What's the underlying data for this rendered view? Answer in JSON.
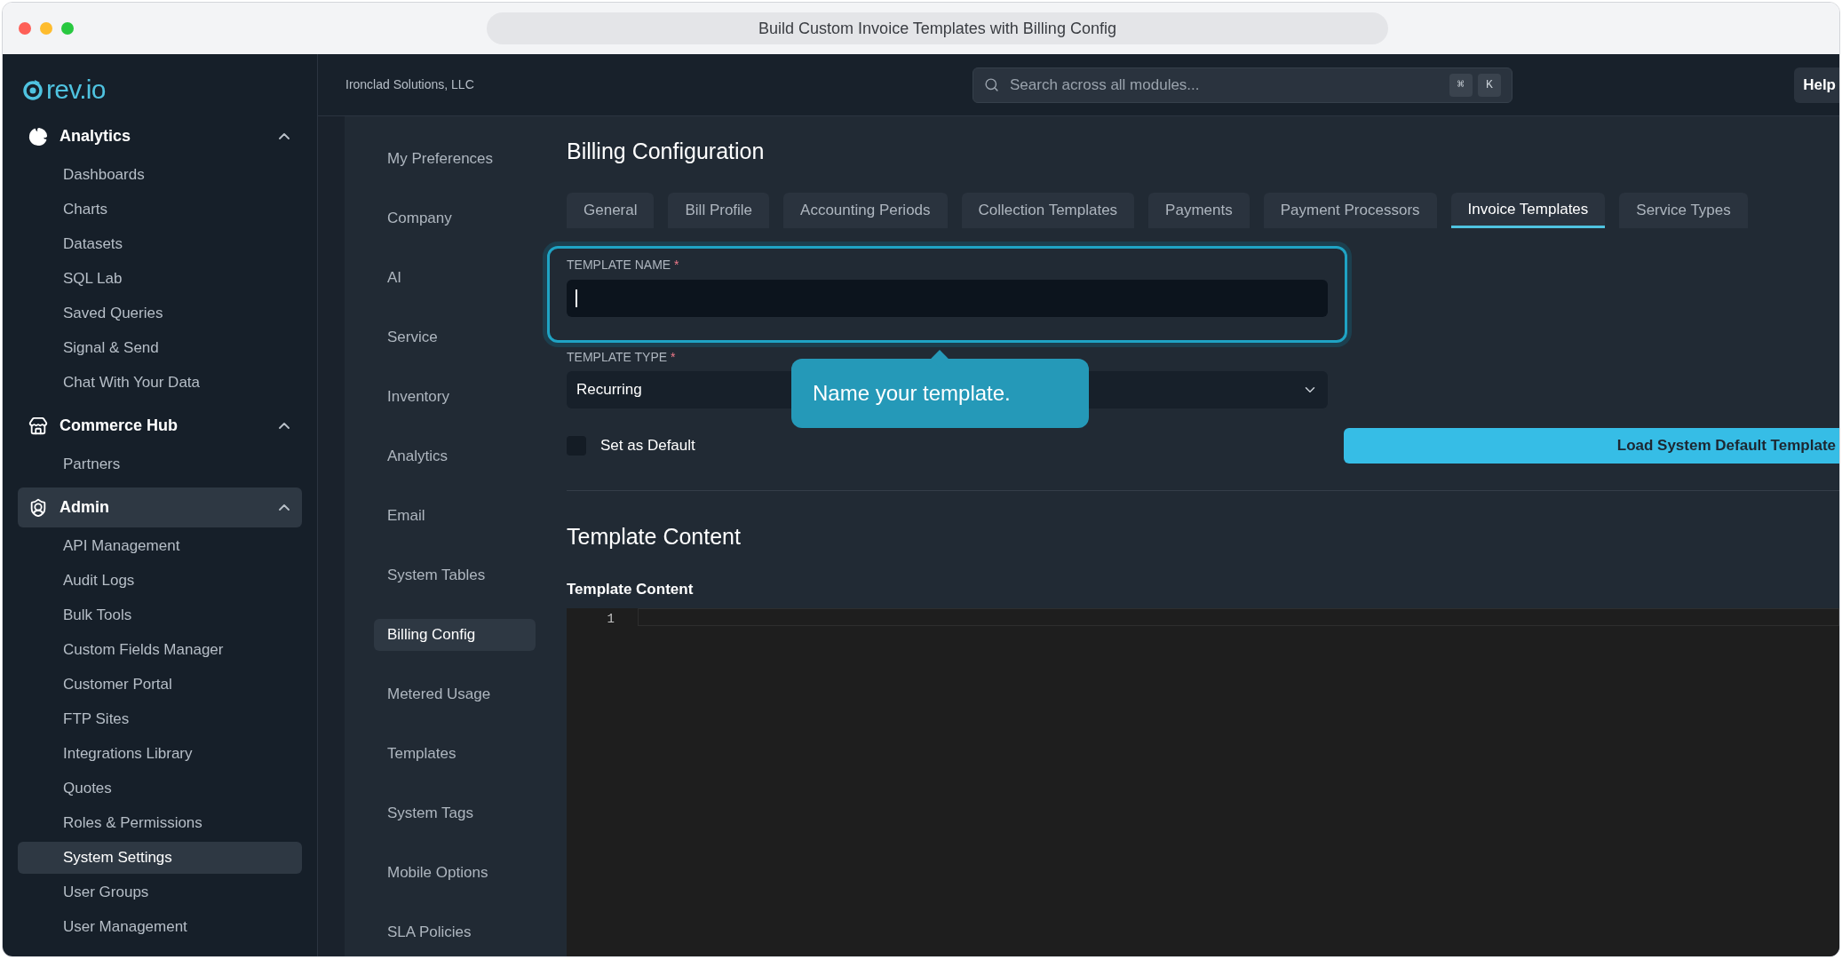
{
  "window": {
    "title": "Build Custom Invoice Templates with Billing Config"
  },
  "sidebar": {
    "logo": "rev.io",
    "sections": [
      {
        "label": "Analytics",
        "expanded": true,
        "active": false,
        "items": [
          {
            "label": "Dashboards",
            "selected": false
          },
          {
            "label": "Charts",
            "selected": false
          },
          {
            "label": "Datasets",
            "selected": false
          },
          {
            "label": "SQL Lab",
            "selected": false
          },
          {
            "label": "Saved Queries",
            "selected": false
          },
          {
            "label": "Signal & Send",
            "selected": false
          },
          {
            "label": "Chat With Your Data",
            "selected": false
          }
        ]
      },
      {
        "label": "Commerce Hub",
        "expanded": true,
        "active": false,
        "items": [
          {
            "label": "Partners",
            "selected": false
          }
        ]
      },
      {
        "label": "Admin",
        "expanded": true,
        "active": true,
        "items": [
          {
            "label": "API Management",
            "selected": false
          },
          {
            "label": "Audit Logs",
            "selected": false
          },
          {
            "label": "Bulk Tools",
            "selected": false
          },
          {
            "label": "Custom Fields Manager",
            "selected": false
          },
          {
            "label": "Customer Portal",
            "selected": false
          },
          {
            "label": "FTP Sites",
            "selected": false
          },
          {
            "label": "Integrations Library",
            "selected": false
          },
          {
            "label": "Quotes",
            "selected": false
          },
          {
            "label": "Roles & Permissions",
            "selected": false
          },
          {
            "label": "System Settings",
            "selected": true
          },
          {
            "label": "User Groups",
            "selected": false
          },
          {
            "label": "User Management",
            "selected": false
          }
        ]
      }
    ]
  },
  "header": {
    "company": "Ironclad Solutions, LLC",
    "search": {
      "placeholder": "Search across all modules...",
      "keys": [
        "⌘",
        "K"
      ]
    },
    "help_button": "Help"
  },
  "settings_nav": [
    {
      "label": "My Preferences",
      "selected": false
    },
    {
      "label": "Company",
      "selected": false
    },
    {
      "label": "AI",
      "selected": false
    },
    {
      "label": "Service",
      "selected": false
    },
    {
      "label": "Inventory",
      "selected": false
    },
    {
      "label": "Analytics",
      "selected": false
    },
    {
      "label": "Email",
      "selected": false
    },
    {
      "label": "System Tables",
      "selected": false
    },
    {
      "label": "Billing Config",
      "selected": true
    },
    {
      "label": "Metered Usage",
      "selected": false
    },
    {
      "label": "Templates",
      "selected": false
    },
    {
      "label": "System Tags",
      "selected": false
    },
    {
      "label": "Mobile Options",
      "selected": false
    },
    {
      "label": "SLA Policies",
      "selected": false
    }
  ],
  "page": {
    "title": "Billing Configuration",
    "tabs": [
      {
        "label": "General",
        "selected": false
      },
      {
        "label": "Bill Profile",
        "selected": false
      },
      {
        "label": "Accounting Periods",
        "selected": false
      },
      {
        "label": "Collection Templates",
        "selected": false
      },
      {
        "label": "Payments",
        "selected": false
      },
      {
        "label": "Payment Processors",
        "selected": false
      },
      {
        "label": "Invoice Templates",
        "selected": true
      },
      {
        "label": "Service Types",
        "selected": false
      }
    ],
    "template_name": {
      "label": "TEMPLATE NAME",
      "required_mark": "*",
      "focused": true
    },
    "template_type": {
      "label": "TEMPLATE TYPE",
      "required_mark": "*",
      "value": "Recurring"
    },
    "default_checkbox": {
      "label": "Set as Default",
      "checked": false
    },
    "load_button": "Load System Default Template",
    "content_heading": "Template Content",
    "editor": {
      "label": "Template Content",
      "line_numbers": [
        "1"
      ]
    },
    "tooltip": "Name your template."
  }
}
